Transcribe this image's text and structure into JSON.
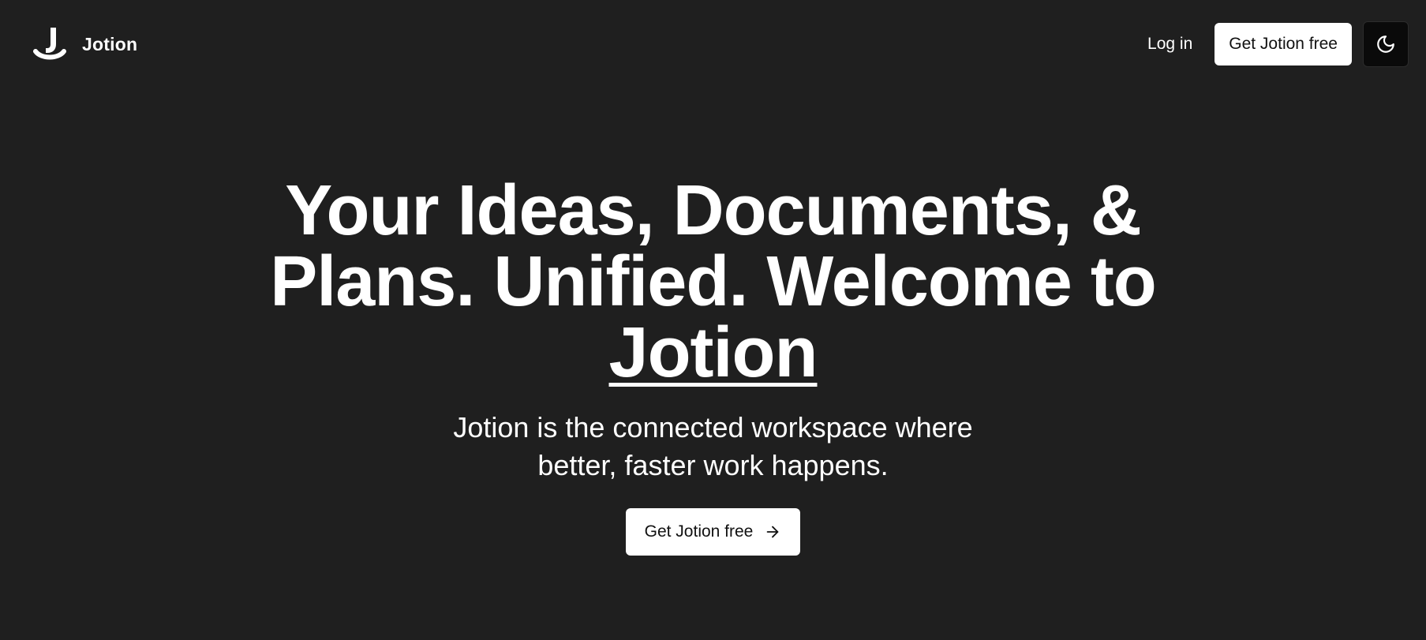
{
  "header": {
    "brand_name": "Jotion",
    "logo_icon": "jotion-logo-icon",
    "login_label": "Log in",
    "cta_label": "Get Jotion free",
    "theme_toggle_icon": "moon-icon"
  },
  "hero": {
    "title_text": "Your Ideas, Documents, & Plans. Unified. Welcome to",
    "title_brand": "Jotion",
    "subtitle": "Jotion is the connected workspace where better, faster work happens.",
    "cta_label": "Get Jotion free",
    "cta_icon": "arrow-right-icon"
  },
  "colors": {
    "background": "#1f1f1f",
    "text": "#ffffff",
    "button_bg": "#ffffff",
    "button_text": "#111111",
    "toggle_bg": "#0a0a0a"
  }
}
